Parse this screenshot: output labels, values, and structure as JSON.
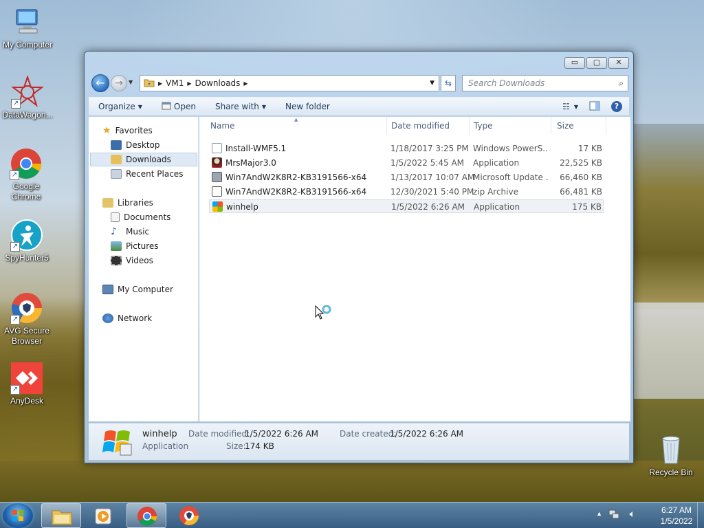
{
  "desktop": {
    "icons": [
      {
        "label": "My Computer"
      },
      {
        "label": "DataWagon..."
      },
      {
        "label": "Google Chrome"
      },
      {
        "label": "SpyHunter5"
      },
      {
        "label": "AVG Secure Browser"
      },
      {
        "label": "AnyDesk"
      },
      {
        "label": "Recycle Bin"
      }
    ]
  },
  "window": {
    "caption_buttons": {
      "minimize": "▭",
      "maximize": "▢",
      "close": "✕"
    },
    "breadcrumb": [
      "VM1",
      "Downloads"
    ],
    "search_placeholder": "Search Downloads",
    "toolbar": {
      "organize": "Organize",
      "open": "Open",
      "share_with": "Share with",
      "new_folder": "New folder"
    },
    "nav_pane": {
      "favorites_header": "Favorites",
      "favorites": [
        "Desktop",
        "Downloads",
        "Recent Places"
      ],
      "libraries_header": "Libraries",
      "libraries": [
        "Documents",
        "Music",
        "Pictures",
        "Videos"
      ],
      "computer": "My Computer",
      "network": "Network",
      "selected": "Downloads"
    },
    "columns": {
      "name": "Name",
      "date": "Date modified",
      "type": "Type",
      "size": "Size"
    },
    "files": [
      {
        "name": "Install-WMF5.1",
        "date": "1/18/2017 3:25 PM",
        "type": "Windows PowerS...",
        "size": "17 KB"
      },
      {
        "name": "MrsMajor3.0",
        "date": "1/5/2022 5:45 AM",
        "type": "Application",
        "size": "22,525 KB"
      },
      {
        "name": "Win7AndW2K8R2-KB3191566-x64",
        "date": "1/13/2017 10:07 AM",
        "type": "Microsoft Update ...",
        "size": "66,460 KB"
      },
      {
        "name": "Win7AndW2K8R2-KB3191566-x64",
        "date": "12/30/2021 5:40 PM",
        "type": "zip Archive",
        "size": "66,481 KB"
      },
      {
        "name": "winhelp",
        "date": "1/5/2022 6:26 AM",
        "type": "Application",
        "size": "175 KB"
      }
    ],
    "details": {
      "name": "winhelp",
      "kind": "Application",
      "date_modified_label": "Date modified:",
      "date_modified": "1/5/2022 6:26 AM",
      "date_created_label": "Date created:",
      "date_created": "1/5/2022 6:26 AM",
      "size_label": "Size:",
      "size": "174 KB"
    }
  },
  "taskbar": {
    "time": "6:27 AM",
    "date": "1/5/2022"
  }
}
